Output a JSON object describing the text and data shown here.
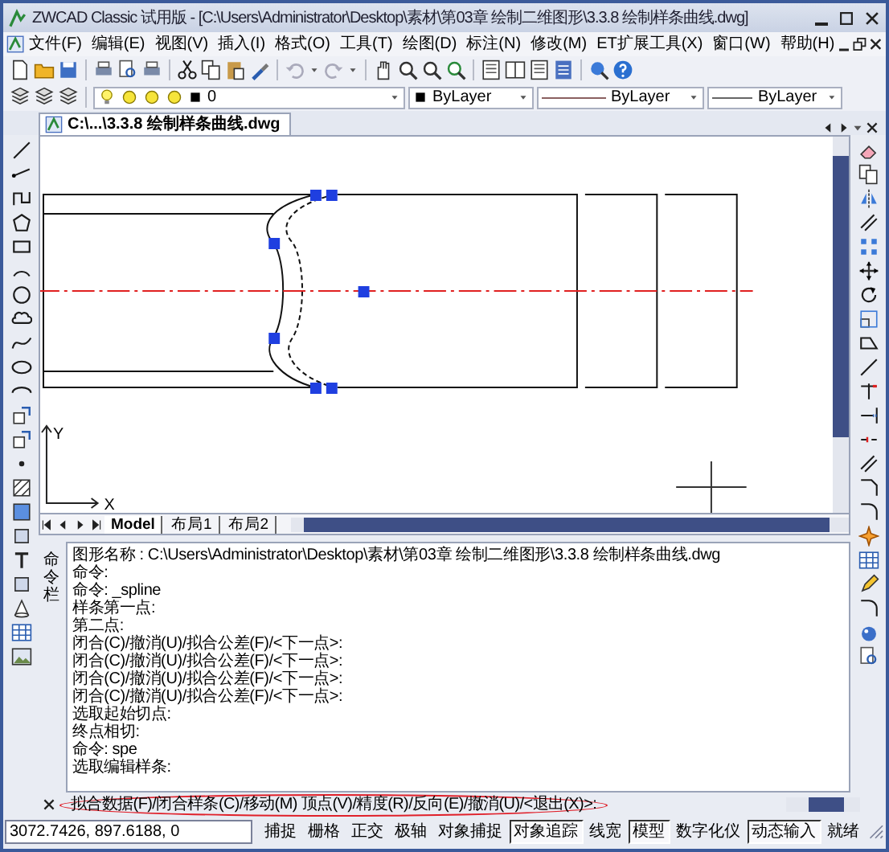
{
  "window": {
    "title": "ZWCAD Classic 试用版 - [C:\\Users\\Administrator\\Desktop\\素材\\第03章 绘制二维图形\\3.3.8  绘制样条曲线.dwg]"
  },
  "menu": [
    "文件(F)",
    "编辑(E)",
    "视图(V)",
    "插入(I)",
    "格式(O)",
    "工具(T)",
    "绘图(D)",
    "标注(N)",
    "修改(M)",
    "ET扩展工具(X)",
    "窗口(W)",
    "帮助(H)"
  ],
  "properties": {
    "layer": "0",
    "color_setting": "ByLayer",
    "linetype": "ByLayer",
    "lineweight": "ByLayer"
  },
  "document_tab": {
    "title": "C:\\...\\3.3.8  绘制样条曲线.dwg"
  },
  "ucs": {
    "x_label": "X",
    "y_label": "Y"
  },
  "layout_tabs": [
    {
      "label": "Model",
      "selected": true
    },
    {
      "label": "布局1",
      "selected": false
    },
    {
      "label": "布局2",
      "selected": false
    }
  ],
  "command_window": {
    "label": "命令栏",
    "history": [
      "图形名称 : C:\\Users\\Administrator\\Desktop\\素材\\第03章 绘制二维图形\\3.3.8  绘制样条曲线.dwg",
      "命令:",
      "命令: _spline",
      "样条第一点:",
      "第二点:",
      "闭合(C)/撤消(U)/拟合公差(F)/<下一点>:",
      "闭合(C)/撤消(U)/拟合公差(F)/<下一点>:",
      "闭合(C)/撤消(U)/拟合公差(F)/<下一点>:",
      "闭合(C)/撤消(U)/拟合公差(F)/<下一点>:",
      "选取起始切点:",
      "终点相切:",
      "命令: spe",
      "选取编辑样条:"
    ],
    "prompt": {
      "text": "拟合数据(F)/闭合样条(C)/移动(M)  顶点(V)/精度(R)/反向(E)/撤消(U)/<退出(X)>:",
      "highlighted": true
    }
  },
  "status_bar": {
    "coordinates": "3072.7426, 897.6188, 0",
    "toggles": [
      {
        "label": "捕捉",
        "on": false
      },
      {
        "label": "栅格",
        "on": false
      },
      {
        "label": "正交",
        "on": false
      },
      {
        "label": "极轴",
        "on": false
      },
      {
        "label": "对象捕捉",
        "on": false
      },
      {
        "label": "对象追踪",
        "on": true
      },
      {
        "label": "线宽",
        "on": false
      },
      {
        "label": "模型",
        "on": true
      },
      {
        "label": "数字化仪",
        "on": false
      },
      {
        "label": "动态输入",
        "on": true
      }
    ],
    "ready": "就绪"
  }
}
